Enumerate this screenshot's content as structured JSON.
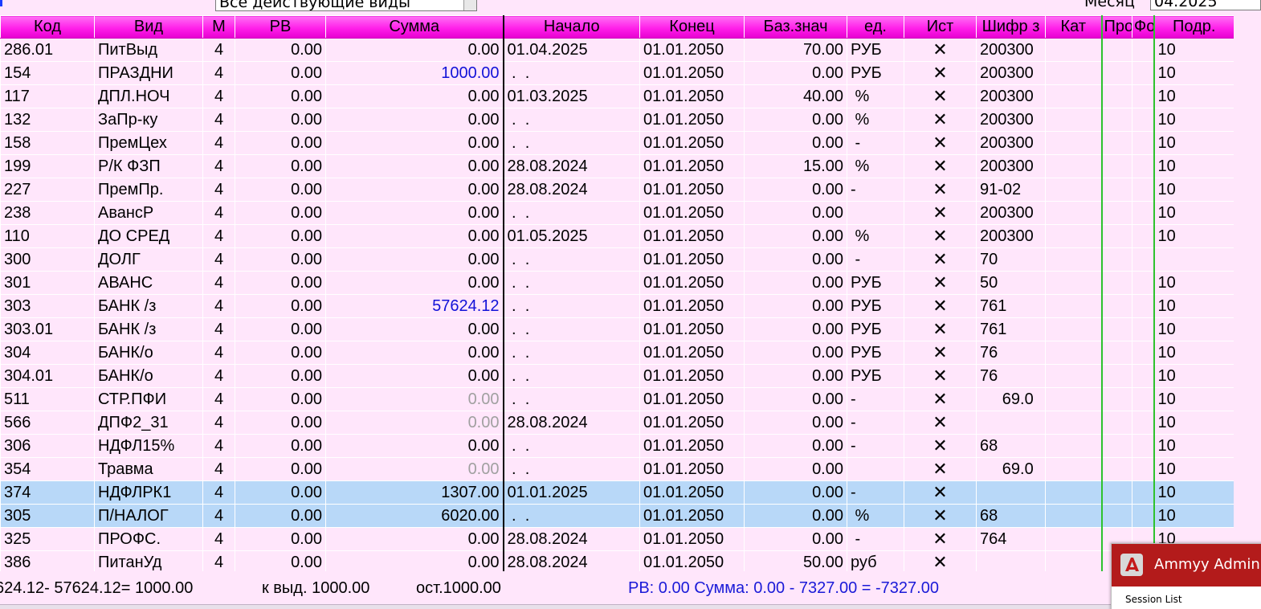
{
  "filter": {
    "selected": "Все действующие виды"
  },
  "month": {
    "label": "Месяц",
    "value": "04.2025"
  },
  "columns": [
    "Код",
    "Вид",
    "М",
    "РВ",
    "Сумма",
    "Начало",
    "Конец",
    "Баз.знач",
    "ед.",
    "Ист",
    "Шифр з",
    "Кат",
    "Про",
    "Фо",
    "Подр."
  ],
  "rows": [
    [
      "286.01",
      "ПитВыд",
      "4",
      "0.00",
      "0.00",
      "01.04.2025",
      "01.01.2050",
      "70.00",
      "РУБ",
      "✕",
      "200300",
      "",
      "",
      "",
      "10"
    ],
    [
      "154",
      "ПРАЗДНИ",
      "4",
      "0.00",
      "1000.00",
      " .  .",
      "01.01.2050",
      "0.00",
      "РУБ",
      "✕",
      "200300",
      "",
      "",
      "",
      "10"
    ],
    [
      "117",
      "ДПЛ.НОЧ",
      "4",
      "0.00",
      "0.00",
      "01.03.2025",
      "01.01.2050",
      "40.00",
      " %",
      "✕",
      "200300",
      "",
      "",
      "",
      "10"
    ],
    [
      "132",
      "ЗаПр-ку",
      "4",
      "0.00",
      "0.00",
      " .  .",
      "01.01.2050",
      "0.00",
      " %",
      "✕",
      "200300",
      "",
      "",
      "",
      "10"
    ],
    [
      "158",
      "ПремЦех",
      "4",
      "0.00",
      "0.00",
      " .  .",
      "01.01.2050",
      "0.00",
      " -",
      "✕",
      "200300",
      "",
      "",
      "",
      "10"
    ],
    [
      "199",
      "Р/К ФЗП",
      "4",
      "0.00",
      "0.00",
      "28.08.2024",
      "01.01.2050",
      "15.00",
      " %",
      "✕",
      "200300",
      "",
      "",
      "",
      "10"
    ],
    [
      "227",
      "ПремПр.",
      "4",
      "0.00",
      "0.00",
      "28.08.2024",
      "01.01.2050",
      "0.00",
      "-",
      "✕",
      "91-02",
      "",
      "",
      "",
      "10"
    ],
    [
      "238",
      "АвансР",
      "4",
      "0.00",
      "0.00",
      " .  .",
      "01.01.2050",
      "0.00",
      "",
      "✕",
      "200300",
      "",
      "",
      "",
      "10"
    ],
    [
      "110",
      "ДО СРЕД",
      "4",
      "0.00",
      "0.00",
      "01.05.2025",
      "01.01.2050",
      "0.00",
      " %",
      "✕",
      "200300",
      "",
      "",
      "",
      "10"
    ],
    [
      "300",
      "ДОЛГ",
      "4",
      "0.00",
      "0.00",
      " .  .",
      "01.01.2050",
      "0.00",
      " -",
      "✕",
      "70",
      "",
      "",
      "",
      ""
    ],
    [
      "301",
      "АВАНС",
      "4",
      "0.00",
      "0.00",
      " .  .",
      "01.01.2050",
      "0.00",
      "РУБ",
      "✕",
      "50",
      "",
      "",
      "",
      "10"
    ],
    [
      "303",
      "БАНК /з",
      "4",
      "0.00",
      "57624.12",
      " .  .",
      "01.01.2050",
      "0.00",
      "РУБ",
      "✕",
      "761",
      "",
      "",
      "",
      "10"
    ],
    [
      "303.01",
      "БАНК /з",
      "4",
      "0.00",
      "0.00",
      " .  .",
      "01.01.2050",
      "0.00",
      "РУБ",
      "✕",
      "761",
      "",
      "",
      "",
      "10"
    ],
    [
      "304",
      "БАНК/о",
      "4",
      "0.00",
      "0.00",
      " .  .",
      "01.01.2050",
      "0.00",
      "РУБ",
      "✕",
      "76",
      "",
      "",
      "",
      "10"
    ],
    [
      "304.01",
      "БАНК/о",
      "4",
      "0.00",
      "0.00",
      " .  .",
      "01.01.2050",
      "0.00",
      "РУБ",
      "✕",
      "76",
      "",
      "",
      "",
      "10"
    ],
    [
      "511",
      "СТР.ПФИ",
      "4",
      "0.00",
      "0.00",
      " .  .",
      "01.01.2050",
      "0.00",
      "-",
      "✕",
      "     69.0",
      "",
      "",
      "",
      "10"
    ],
    [
      "566",
      "ДПФ2_31",
      "4",
      "0.00",
      "0.00",
      "28.08.2024",
      "01.01.2050",
      "0.00",
      "-",
      "✕",
      "",
      "",
      "",
      "",
      "10"
    ],
    [
      "306",
      "НДФЛ15%",
      "4",
      "0.00",
      "0.00",
      " .  .",
      "01.01.2050",
      "0.00",
      "-",
      "✕",
      "68",
      "",
      "",
      "",
      "10"
    ],
    [
      "354",
      "Травма",
      "4",
      "0.00",
      "0.00",
      " .  .",
      "01.01.2050",
      "0.00",
      "",
      "✕",
      "     69.0",
      "",
      "",
      "",
      "10"
    ],
    [
      "374",
      "НДФЛРК1",
      "4",
      "0.00",
      "1307.00",
      "01.01.2025",
      "01.01.2050",
      "0.00",
      "-",
      "✕",
      "",
      "",
      "",
      "",
      "10"
    ],
    [
      "305",
      "П/НАЛОГ",
      "4",
      "0.00",
      "6020.00",
      " .  .",
      "01.01.2050",
      "0.00",
      " %",
      "✕",
      "68",
      "",
      "",
      "",
      "10"
    ],
    [
      "325",
      "ПРОФС.",
      "4",
      "0.00",
      "0.00",
      "28.08.2024",
      "01.01.2050",
      "0.00",
      " -",
      "✕",
      "764",
      "",
      "",
      "",
      "10"
    ],
    [
      "386",
      "ПитанУд",
      "4",
      "0.00",
      "0.00",
      "28.08.2024",
      "01.01.2050",
      "50.00",
      "руб",
      "✕",
      "",
      "",
      "",
      "",
      ""
    ]
  ],
  "row_states": [
    "n",
    "n",
    "n",
    "n",
    "n",
    "n",
    "n",
    "n",
    "n",
    "n",
    "n",
    "n",
    "n",
    "n",
    "n",
    "n",
    "n",
    "n",
    "n",
    "sel",
    "sel",
    "n",
    "n"
  ],
  "sum_styles": [
    "",
    "blue",
    "",
    "",
    "",
    "",
    "",
    "",
    "",
    "",
    "",
    "blue",
    "",
    "",
    "",
    "gray",
    "gray",
    "",
    "gray",
    "",
    "",
    "",
    ""
  ],
  "status": {
    "balance": "624.12- 57624.12= 1000.00",
    "issue": "к выд. 1000.00",
    "rest": "ост.1000.00",
    "rv_summary": "РВ:  0.00  Сумма: 0.00 - 7327.00 = -7327.00"
  },
  "popup": {
    "title": "Ammyy Admin",
    "subtitle": "Session List"
  },
  "colors": {
    "header": "#ff1fe9",
    "row_bg": "#ffe6fb",
    "selected_row": "#b8d8f8",
    "blue_text": "#1212d8",
    "gray_text": "#a0a0a0",
    "popup_header": "#b31b1b"
  }
}
